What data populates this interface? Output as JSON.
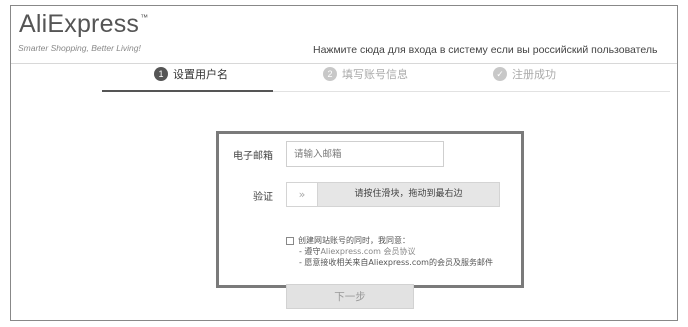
{
  "header": {
    "logo_text": "AliExpress",
    "logo_tm": "™",
    "tagline": "Smarter Shopping, Better Living!",
    "russian_login_link": "Нажмите сюда для входа в систему если вы российский пользователь"
  },
  "steps": [
    {
      "number": "1",
      "label": "设置用户名",
      "state": "active"
    },
    {
      "number": "2",
      "label": "填写账号信息",
      "state": "inactive"
    },
    {
      "number": "✓",
      "label": "注册成功",
      "state": "inactive"
    }
  ],
  "form": {
    "email_label": "电子邮箱",
    "email_placeholder": "请输入邮箱",
    "email_value": "",
    "verify_label": "验证",
    "slider_handle_glyph": "»",
    "slider_text": "请按住滑块，拖动到最右边",
    "agree_text": "创建网站账号的同时，我同意：",
    "agree_item1_prefix": "- 遵守",
    "agree_item1_link": "Aliexpress.com 会员协议",
    "agree_item2": "- 愿意接收相关来自Aliexpress.com的会员及服务邮件",
    "next_button": "下一步"
  },
  "colors": {
    "frame_border": "#888888",
    "highlight_box": "#7a7a7a",
    "active_step": "#555555",
    "inactive_step": "#c8c8c8"
  }
}
